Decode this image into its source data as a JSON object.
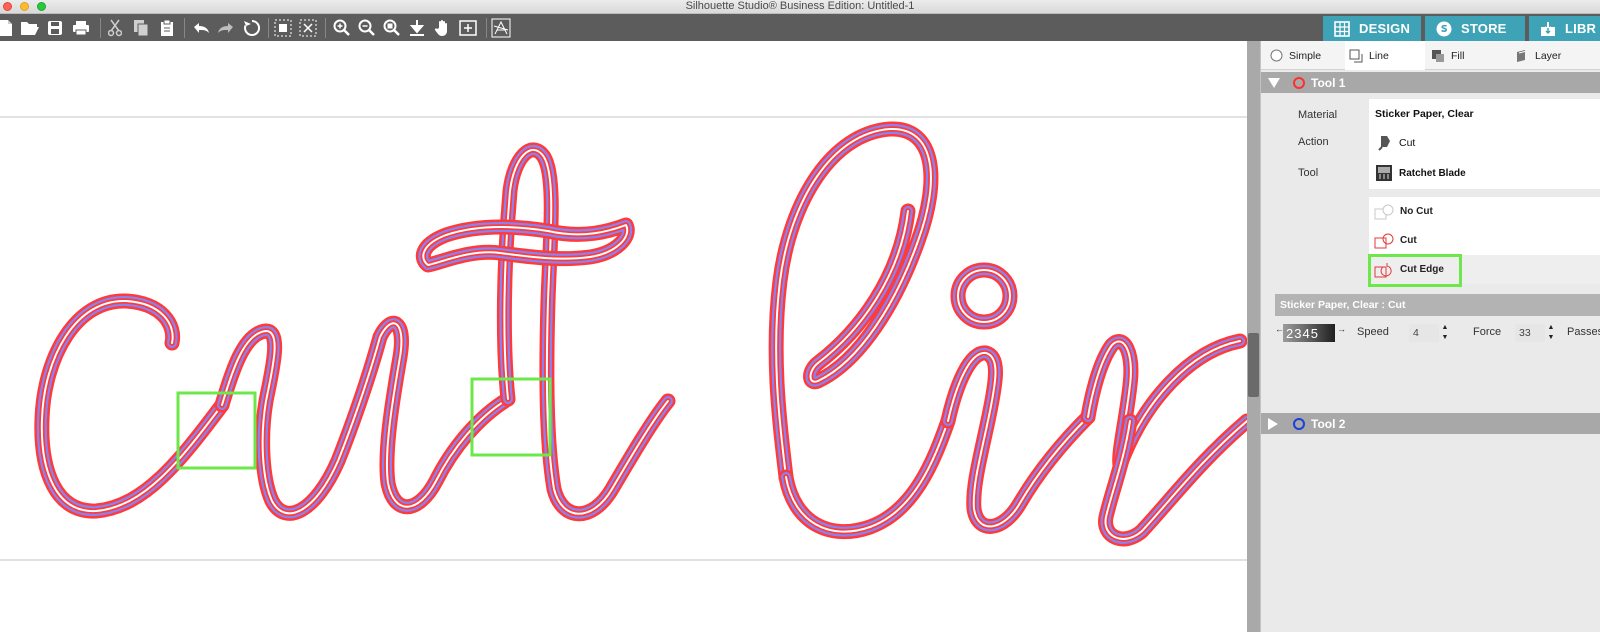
{
  "window": {
    "title": "Silhouette Studio® Business Edition: Untitled-1"
  },
  "toolbar": {
    "icons": [
      "new-document-icon",
      "open-folder-icon",
      "save-icon",
      "print-icon",
      "cut-icon",
      "copy-icon",
      "paste-icon",
      "undo-icon",
      "redo-icon",
      "redraw-icon",
      "select-all-icon",
      "deselect-icon",
      "zoom-in-icon",
      "zoom-out-icon",
      "zoom-fit-icon",
      "move-down-icon",
      "pan-hand-icon",
      "fit-to-page-icon",
      "trace-icon"
    ]
  },
  "nav_tabs": {
    "design": "DESIGN",
    "store": "STORE",
    "library": "LIBR"
  },
  "canvas": {
    "text": "cut lin",
    "fill_color": "#8a82f2",
    "cut_line_color": "#ff3a3a",
    "highlight_color": "#6de84a"
  },
  "panel": {
    "tabs": {
      "simple": "Simple",
      "line": "Line",
      "fill": "Fill",
      "layer": "Layer"
    },
    "tool1": {
      "title": "Tool 1",
      "color": "#ff2f2f",
      "material_label": "Material",
      "material_value": "Sticker Paper, Clear",
      "action_label": "Action",
      "action_value": "Cut",
      "tool_label": "Tool",
      "tool_value": "Ratchet Blade",
      "options": {
        "no_cut": "No Cut",
        "cut": "Cut",
        "cut_edge": "Cut Edge"
      },
      "selected_option": "Cut Edge",
      "settings_header": "Sticker Paper, Clear : Cut",
      "speed_scale": "2345",
      "speed_label": "Speed",
      "speed_value": "4",
      "force_label": "Force",
      "force_value": "33",
      "passes_label": "Passes"
    },
    "tool2": {
      "title": "Tool 2",
      "color": "#1a3fe0"
    }
  }
}
